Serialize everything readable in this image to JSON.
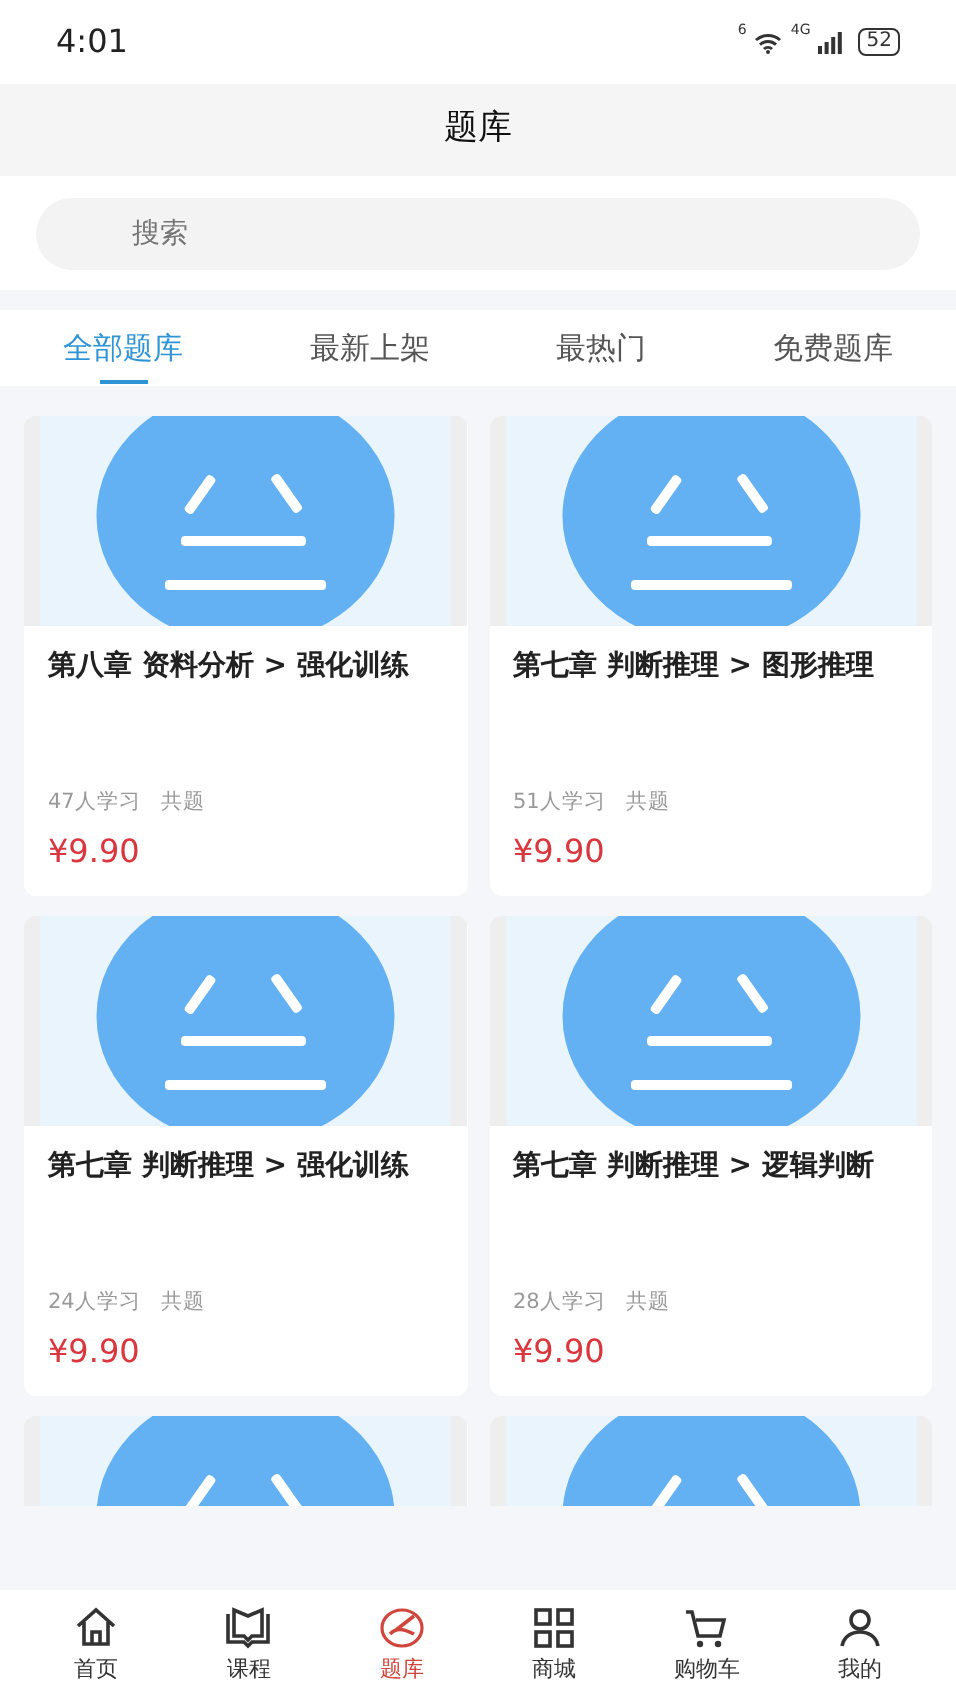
{
  "status_bar": {
    "time": "4:01",
    "wifi_label": "6",
    "network": "4G",
    "battery": "52"
  },
  "header": {
    "title": "题库"
  },
  "search": {
    "placeholder": "搜索"
  },
  "tabs": [
    {
      "label": "全部题库",
      "selected": true
    },
    {
      "label": "最新上架",
      "selected": false
    },
    {
      "label": "最热门",
      "selected": false
    },
    {
      "label": "免费题库",
      "selected": false
    }
  ],
  "cards": [
    {
      "kind": "full",
      "title": "第八章 资料分析 > 强化训练",
      "learners": "47人学习",
      "questions": "共题",
      "price": "¥9.90"
    },
    {
      "kind": "full",
      "title": "第七章 判断推理 > 图形推理",
      "learners": "51人学习",
      "questions": "共题",
      "price": "¥9.90"
    },
    {
      "kind": "full",
      "title": "第七章 判断推理 > 强化训练",
      "learners": "24人学习",
      "questions": "共题",
      "price": "¥9.90"
    },
    {
      "kind": "full",
      "title": "第七章 判断推理 > 逻辑判断",
      "learners": "28人学习",
      "questions": "共题",
      "price": "¥9.90"
    },
    {
      "kind": "picture"
    },
    {
      "kind": "picture"
    }
  ],
  "bottom_nav": [
    {
      "label": "首页",
      "kind": "home",
      "selected": false
    },
    {
      "label": "课程",
      "kind": "book",
      "selected": false
    },
    {
      "label": "题库",
      "kind": "pen",
      "selected": true
    },
    {
      "label": "商城",
      "kind": "grid",
      "selected": false
    },
    {
      "label": "购物车",
      "kind": "cart",
      "selected": false
    },
    {
      "label": "我的",
      "kind": "user",
      "selected": false
    }
  ]
}
